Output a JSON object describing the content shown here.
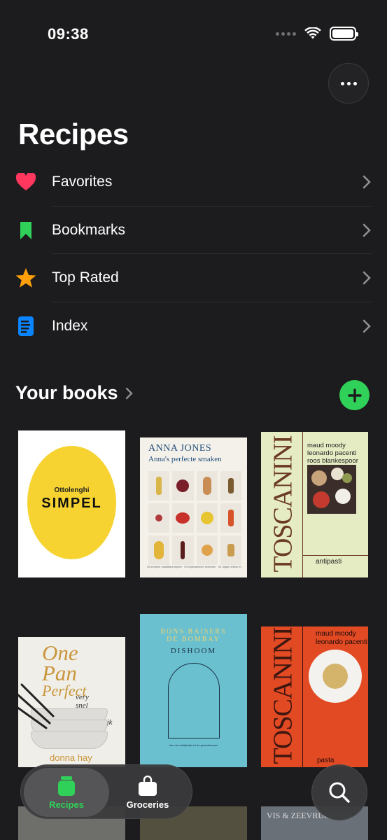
{
  "status_bar": {
    "time": "09:38"
  },
  "page_title": "Recipes",
  "menu": [
    {
      "label": "Favorites",
      "icon": "heart-icon",
      "color": "#ff375f"
    },
    {
      "label": "Bookmarks",
      "icon": "bookmark-icon",
      "color": "#30d158"
    },
    {
      "label": "Top Rated",
      "icon": "star-icon",
      "color": "#ff9f0a"
    },
    {
      "label": "Index",
      "icon": "index-icon",
      "color": "#0a84ff"
    }
  ],
  "books_section": {
    "title": "Your books"
  },
  "books": [
    {
      "author": "Ottolenghi",
      "title": "SIMPEL"
    },
    {
      "author": "ANNA JONES",
      "title": "Anna's perfecte smaken",
      "footer": "45 simpele maaltijdrecepten · 54 vegetarische recepten · 94 dagen lekker eten"
    },
    {
      "title": "TOSCANINI",
      "authors": [
        "maud moody",
        "leonardo pacenti",
        "roos blankespoor"
      ],
      "subtitle": "antipasti"
    },
    {
      "title_lines": [
        "One",
        "Pan",
        "Perfect"
      ],
      "subtitle_lines": [
        "very",
        "snel",
        "eenvoudig",
        "verrukkelijk"
      ],
      "author": "donna hay"
    },
    {
      "top_lines": [
        "BONS BAISERS",
        "DE BOMBAY"
      ],
      "title": "DISHOOM",
      "footer": "Van de ontbijtzaak tot de groentekraam"
    },
    {
      "title": "TOSCANINI",
      "authors": [
        "maud moody",
        "leonardo pacenti"
      ],
      "subtitle": "pasta"
    }
  ],
  "peek_books": [
    {
      "text": ""
    },
    {
      "text": ""
    },
    {
      "text": "VIS & ZEEVRUCHTEN"
    }
  ],
  "tab_bar": {
    "recipes_label": "Recipes",
    "groceries_label": "Groceries"
  },
  "colors": {
    "accent": "#30d158",
    "background": "#1c1c1e"
  }
}
